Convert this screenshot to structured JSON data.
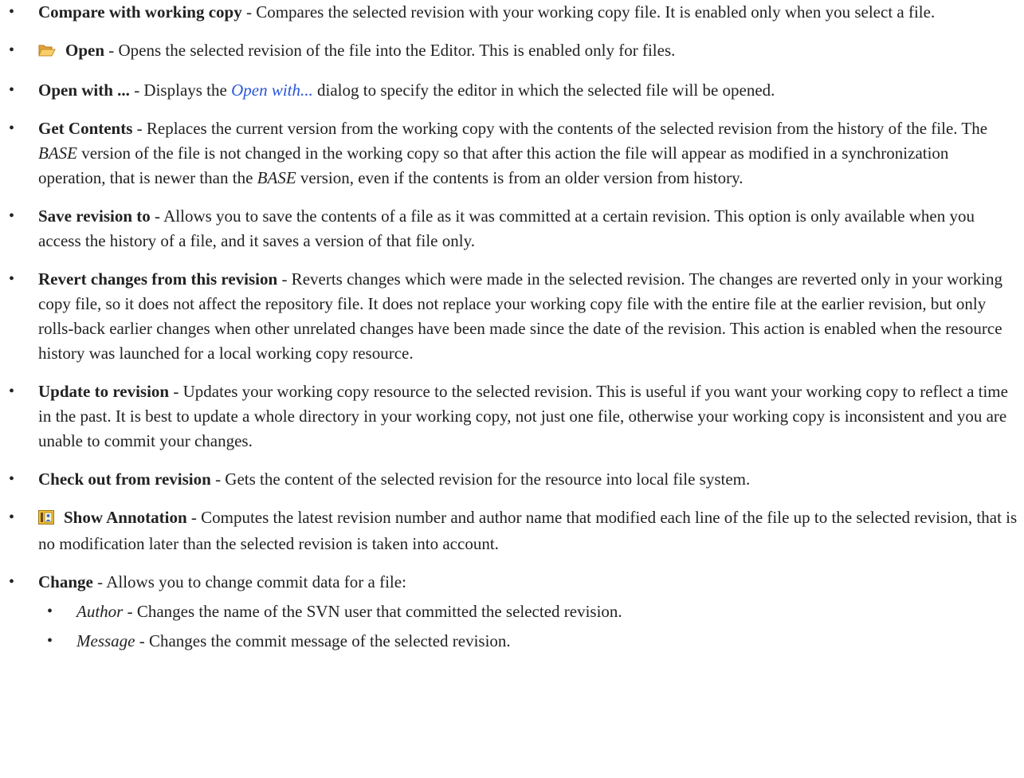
{
  "items": [
    {
      "title": "Compare with working copy",
      "text": " - Compares the selected revision with your working copy file. It is enabled only when you select a file."
    },
    {
      "icon": "open-folder-icon",
      "title": "Open",
      "text": " - Opens the selected revision of the file into the Editor. This is enabled only for files."
    },
    {
      "title": "Open with ...",
      "text_before": " - Displays the ",
      "link": "Open with...",
      "text_after": " dialog to specify the editor in which the selected file will be opened."
    },
    {
      "title": "Get Contents",
      "text_1": " - Replaces the current version from the working copy with the contents of the selected revision from the history of the file. The ",
      "em_1": "BASE",
      "text_2": " version of the file is not changed in the working copy so that after this action the file will appear as modified in a synchronization operation, that is newer than the ",
      "em_2": "BASE",
      "text_3": " version, even if the contents is from an older version from history."
    },
    {
      "title": "Save revision to",
      "text": " - Allows you to save the contents of a file as it was committed at a certain revision. This option is only available when you access the history of a file, and it saves a version of that file only."
    },
    {
      "title": "Revert changes from this revision",
      "text": " - Reverts changes which were made in the selected revision. The changes are reverted only in your working copy file, so it does not affect the repository file. It does not replace your working copy file with the entire file at the earlier revision, but only rolls-back earlier changes when other unrelated changes have been made since the date of the revision. This action is enabled when the resource history was launched for a local working copy resource."
    },
    {
      "title": "Update to revision",
      "text": " - Updates your working copy resource to the selected revision. This is useful if you want your working copy to reflect a time in the past. It is best to update a whole directory in your working copy, not just one file, otherwise your working copy is inconsistent and you are unable to commit your changes."
    },
    {
      "title": "Check out from revision",
      "text": " - Gets the content of the selected revision for the resource into local file system."
    },
    {
      "icon": "annotation-icon",
      "title": "Show Annotation",
      "text": " - Computes the latest revision number and author name that modified each line of the file up to the selected revision, that is no modification later than the selected revision is taken into account."
    },
    {
      "title": "Change",
      "text": " - Allows you to change commit data for a file:",
      "subitems": [
        {
          "em": "Author",
          "text": " - Changes the name of the SVN user that committed the selected revision."
        },
        {
          "em": "Message",
          "text": " - Changes the commit message of the selected revision."
        }
      ]
    }
  ],
  "bullet": "•",
  "colors": {
    "text": "#222222",
    "link": "#2a55d6"
  }
}
